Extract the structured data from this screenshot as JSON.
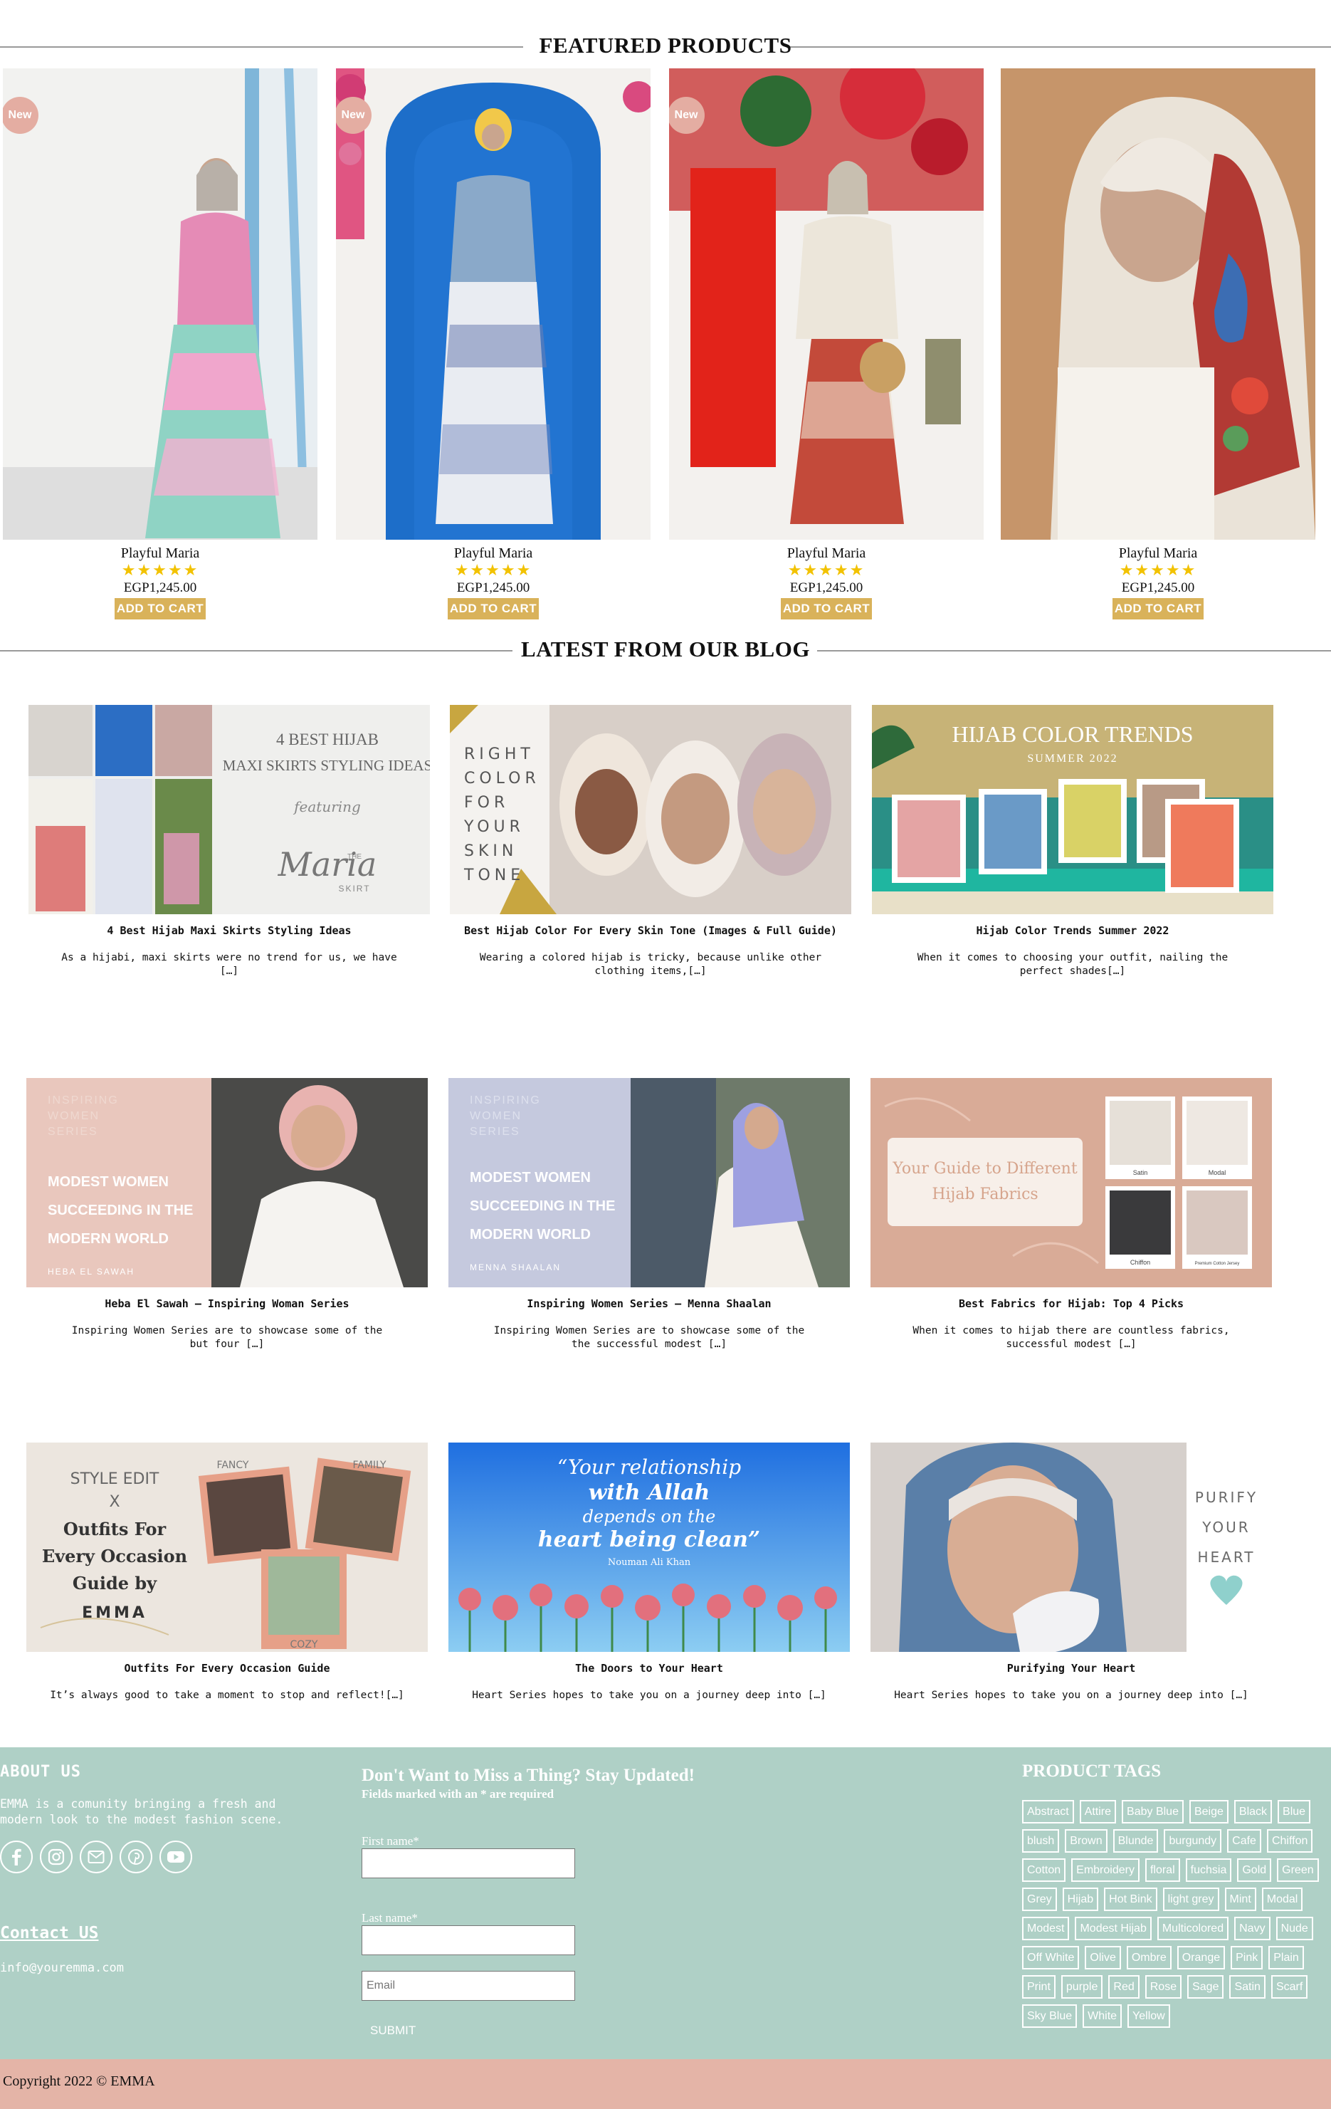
{
  "featured": {
    "title": "FEATURED PRODUCTS",
    "products": [
      {
        "badge": "New",
        "name": "Playful Maria",
        "stars": "★★★★★",
        "price": "EGP1,245.00",
        "cta": "ADD TO CART"
      },
      {
        "badge": "New",
        "name": "Playful Maria",
        "stars": "★★★★★",
        "price": "EGP1,245.00",
        "cta": "ADD TO CART"
      },
      {
        "badge": "New",
        "name": "Playful Maria",
        "stars": "★★★★★",
        "price": "EGP1,245.00",
        "cta": "ADD TO CART"
      },
      {
        "badge": "",
        "name": "Playful Maria",
        "stars": "★★★★★",
        "price": "EGP1,245.00",
        "cta": "ADD TO CART"
      }
    ]
  },
  "blog": {
    "title": "LATEST FROM OUR BLOG",
    "posts": [
      {
        "title": "4 Best Hijab Maxi Skirts Styling Ideas",
        "excerpt": "As a hijabi, maxi skirts were no trend for us, we have […]",
        "image_text": [
          "4 BEST HIJAB",
          "MAXI SKIRTS STYLING IDEAS",
          "featuring",
          "Maria",
          "THE",
          "SKIRT"
        ]
      },
      {
        "title": "Best Hijab Color For Every Skin Tone (Images & Full Guide)",
        "excerpt": "Wearing a colored hijab is tricky, because unlike other clothing items,[…]",
        "image_text": [
          "RIGHT",
          "COLOR",
          "FOR",
          "YOUR",
          "SKIN",
          "TONE"
        ]
      },
      {
        "title": "Hijab Color Trends Summer 2022",
        "excerpt": "When it comes to choosing your outfit, nailing the perfect shades[…]",
        "image_text": [
          "HIJAB COLOR TRENDS",
          "SUMMER 2022"
        ]
      },
      {
        "title": "Heba El Sawah – Inspiring Woman Series",
        "excerpt": "Inspiring Women Series are to showcase some of the but four […]",
        "image_text": [
          "INSPIRING",
          "WOMEN",
          "SERIES",
          "MODEST WOMEN",
          "SUCCEEDING IN THE",
          "MODERN WORLD",
          "HEBA EL SAWAH"
        ]
      },
      {
        "title": "Inspiring Women Series – Menna Shaalan",
        "excerpt": "Inspiring Women Series are to showcase some of the the successful modest […]",
        "image_text": [
          "INSPIRING",
          "WOMEN",
          "SERIES",
          "MODEST WOMEN",
          "SUCCEEDING IN THE",
          "MODERN WORLD",
          "MENNA SHAALAN"
        ]
      },
      {
        "title": "Best Fabrics for Hijab: Top 4 Picks",
        "excerpt": "When it comes to hijab there are countless fabrics, successful modest […]",
        "image_text": [
          "Your Guide to Different",
          "Hijab Fabrics",
          "Satin",
          "Modal",
          "Chiffon",
          "Premium Cotton Jersey"
        ]
      },
      {
        "title": "Outfits For Every Occasion Guide",
        "excerpt": "It’s always good to take a moment to stop and reflect![…]",
        "image_text": [
          "STYLE EDIT",
          "X",
          "Outfits For",
          "Every Occasion",
          "Guide by",
          "EMMA",
          "FANCY",
          "FAMILY",
          "COZY"
        ]
      },
      {
        "title": "The Doors to Your Heart",
        "excerpt": "Heart Series hopes to take you on a journey deep into […]",
        "image_text": [
          "“Your relationship",
          "with Allah",
          "depends on the",
          "heart being clean”",
          "Nouman Ali Khan"
        ]
      },
      {
        "title": "Purifying Your Heart",
        "excerpt": "Heart Series hopes to take you on a journey deep into […]",
        "image_text": [
          "PURIFY",
          "YOUR",
          "HEART"
        ]
      }
    ]
  },
  "footer": {
    "about_title": "ABOUT US",
    "about_text": "EMMA is a comunity bringing a fresh and modern look to the modest fashion scene.",
    "socials": [
      "facebook-icon",
      "instagram-icon",
      "email-icon",
      "pinterest-icon",
      "youtube-icon"
    ],
    "contact_title": "Contact US",
    "email": "info@youremma.com",
    "newsletter_title": "Don't Want to Miss a Thing? Stay Updated!",
    "required_note": "Fields marked with an * are required",
    "first_name_label": "First name*",
    "last_name_label": "Last name*",
    "email_placeholder": "Email",
    "submit_label": "SUBMIT",
    "tags_title": "PRODUCT TAGS",
    "tags": [
      "Abstract",
      "Attire",
      "Baby Blue",
      "Beige",
      "Black",
      "Blue",
      "blush",
      "Brown",
      "Blunde",
      "burgundy",
      "Cafe",
      "Chiffon",
      "Cotton",
      "Embroidery",
      "floral",
      "fuchsia",
      "Gold",
      "Green",
      "Grey",
      "Hijab",
      "Hot Bink",
      "light grey",
      "Mint",
      "Modal",
      "Modest",
      "Modest Hijab",
      "Multicolored",
      "Navy",
      "Nude",
      "Off White",
      "Olive",
      "Ombre",
      "Orange",
      "Pink",
      "Plain",
      "Print",
      "purple",
      "Red",
      "Rose",
      "Sage",
      "Satin",
      "Scarf",
      "Sky Blue",
      "White",
      "Yellow"
    ],
    "copyright": "Copyright 2022 © EMMA"
  },
  "colors": {
    "footer_bg": "#afd0c6",
    "copyright_bg": "#e4b4a7",
    "cart_button": "#d9b25a",
    "new_badge": "#e4ada2",
    "stars": "#f2c200"
  }
}
